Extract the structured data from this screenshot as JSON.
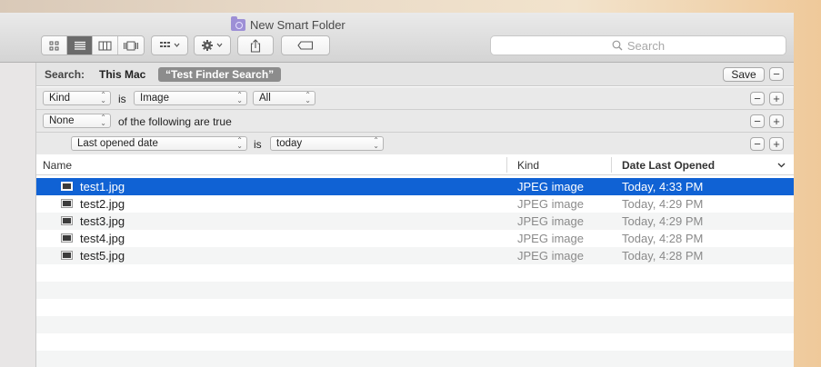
{
  "window": {
    "title": "New Smart Folder"
  },
  "toolbar": {
    "view_buttons": [
      "icon-view-icon",
      "list-view-icon",
      "column-view-icon",
      "cover-flow-icon"
    ],
    "search_placeholder": "Search"
  },
  "searchbar": {
    "label": "Search:",
    "scope_this_mac": "This Mac",
    "scope_query": "“Test Finder Search”",
    "save_label": "Save"
  },
  "criteria": [
    {
      "attribute": "Kind",
      "op": "is",
      "value": "Image",
      "value2": "All"
    },
    {
      "attribute": "None",
      "text": "of the following are true"
    },
    {
      "attribute": "Last opened date",
      "op": "is",
      "value": "today"
    }
  ],
  "columns": {
    "name": "Name",
    "kind": "Kind",
    "date": "Date Last Opened"
  },
  "files": [
    {
      "name": "test1.jpg",
      "kind": "JPEG image",
      "date": "Today, 4:33 PM"
    },
    {
      "name": "test2.jpg",
      "kind": "JPEG image",
      "date": "Today, 4:29 PM"
    },
    {
      "name": "test3.jpg",
      "kind": "JPEG image",
      "date": "Today, 4:29 PM"
    },
    {
      "name": "test4.jpg",
      "kind": "JPEG image",
      "date": "Today, 4:28 PM"
    },
    {
      "name": "test5.jpg",
      "kind": "JPEG image",
      "date": "Today, 4:28 PM"
    }
  ],
  "colors": {
    "selection": "#1062d4",
    "folder_icon": "#9d8fd6"
  }
}
